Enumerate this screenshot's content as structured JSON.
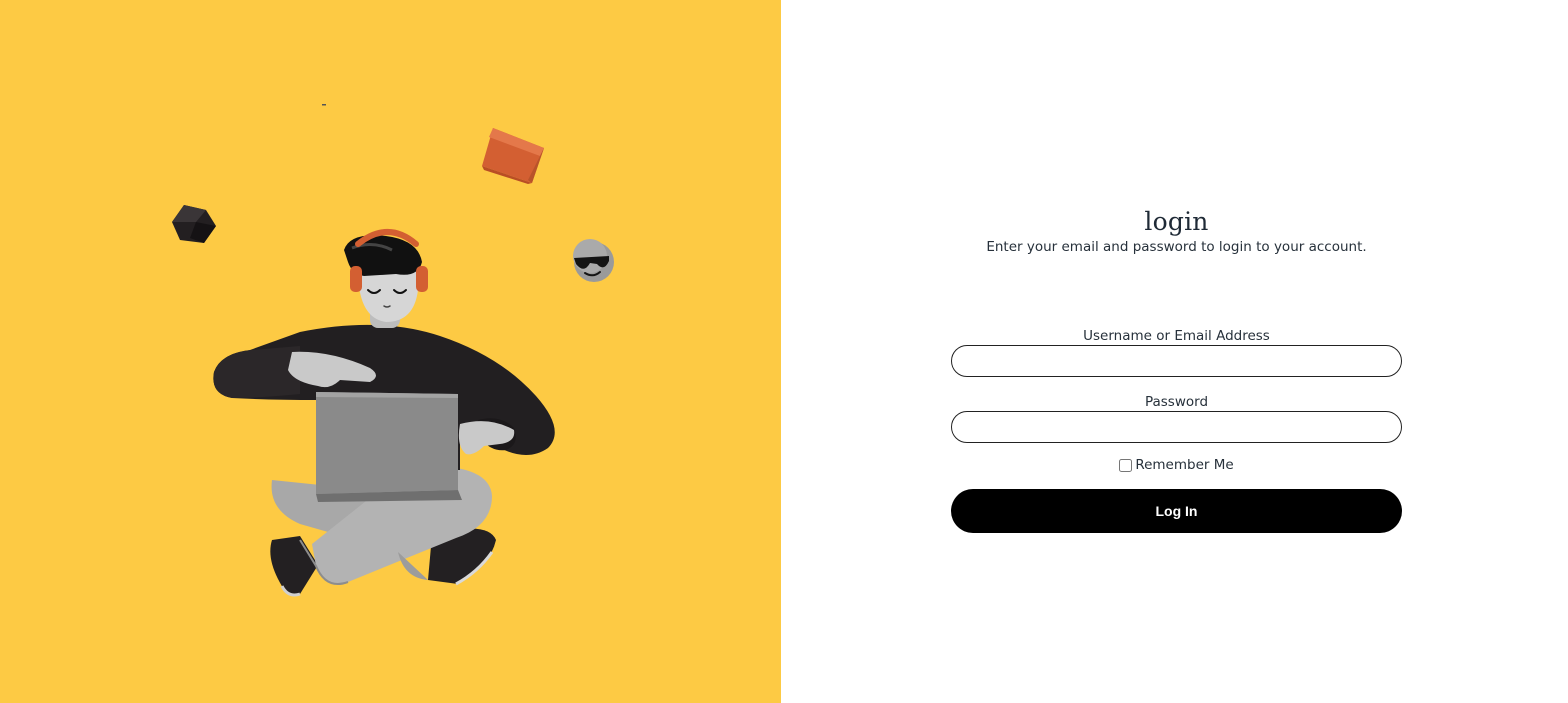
{
  "colors": {
    "hero_background": "#FDCA44",
    "accent_orange": "#D35F32",
    "button_background": "#000000",
    "button_text": "#FFFFFF"
  },
  "hero": {
    "illustration": "3d-character-with-laptop-and-headphones",
    "floating_items": [
      "orange-cube",
      "black-cube",
      "sunglasses-emoji"
    ]
  },
  "login": {
    "title": "login",
    "subtitle": "Enter your email and password to login to your account.",
    "username_label": "Username or Email Address",
    "username_value": "",
    "password_label": "Password",
    "password_value": "",
    "remember_label": "Remember Me",
    "remember_checked": false,
    "submit_label": "Log In"
  }
}
